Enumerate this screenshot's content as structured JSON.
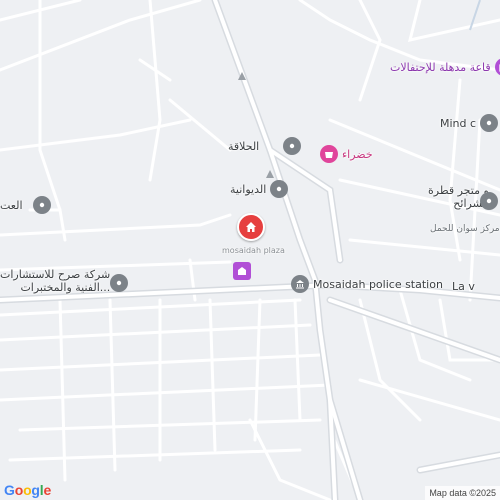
{
  "map": {
    "pois": {
      "hall": "قاعة مدهلة للإحتفالات",
      "mind": "Mind c",
      "barber": "الحلاقة",
      "khadra": "خضراء",
      "diwaniya": "الديوانية",
      "store": "و متجر قطرة",
      "store_sub": "الشرائح",
      "sawwan": "مركز سوان للحمل",
      "left_edge": "العت",
      "sarh": "شركة صرح للاستشارات",
      "sarh_sub": "الفنية والمختبرات...",
      "station": "Mosaidah police station",
      "la": "La v",
      "faded_mid": "mosaidah plaza"
    },
    "attribution": "Map data ©2025",
    "logo": [
      "G",
      "o",
      "o",
      "g",
      "l",
      "e"
    ],
    "colors": {
      "brand_blue": "#4285F4",
      "brand_red": "#EA4335",
      "brand_yellow": "#FBBC05",
      "brand_green": "#34A853",
      "pin_red": "#E63F3F",
      "pin_purple": "#B14FD6",
      "pin_grey": "#7C8288"
    },
    "icons": [
      "home-icon",
      "shop-icon",
      "building-icon",
      "location-icon",
      "police-icon",
      "bag-icon"
    ]
  }
}
